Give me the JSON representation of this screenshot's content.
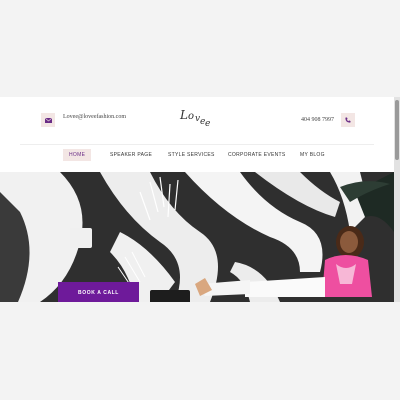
{
  "header": {
    "email": "Lovee@loveefashion.com",
    "phone": "404 908 7997",
    "logo_text": "Lovee",
    "mail_icon": "envelope-icon",
    "phone_icon": "phone-icon"
  },
  "nav": {
    "items": [
      {
        "label": "HOME"
      },
      {
        "label": "SPEAKER PAGE"
      },
      {
        "label": "STYLE SERVICES"
      },
      {
        "label": "CORPORATE EVENTS"
      },
      {
        "label": "MY BLOG"
      }
    ]
  },
  "hero": {
    "cta_label": "BOOK A CALL"
  },
  "colors": {
    "accent": "#6e1a9a",
    "blush": "#f3e6e4",
    "jacket": "#ee4fa0"
  }
}
